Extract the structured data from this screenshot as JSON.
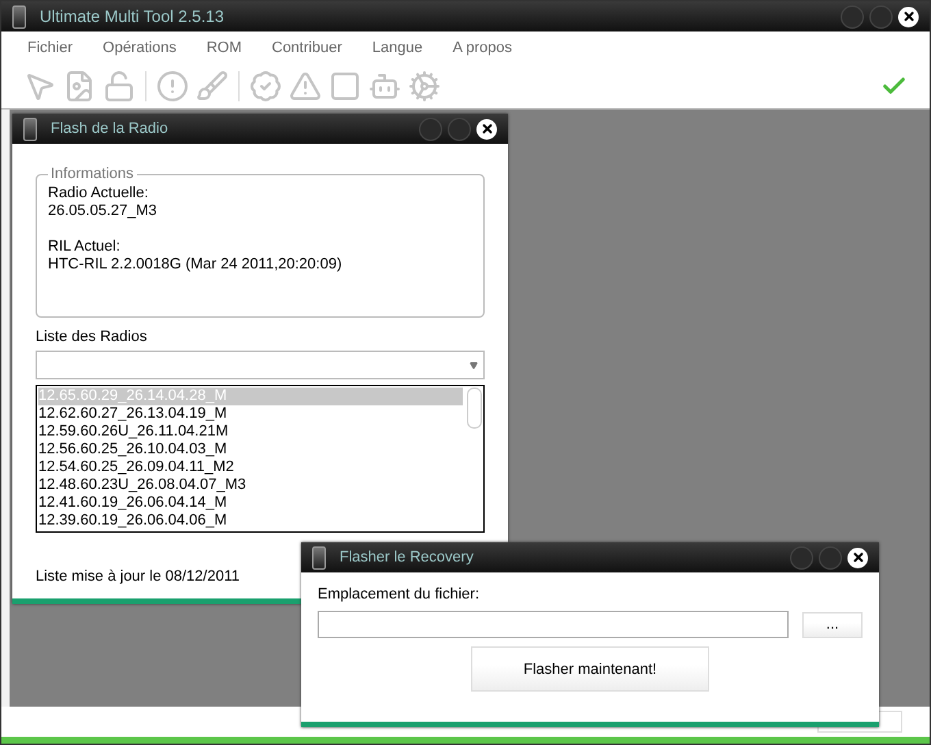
{
  "window": {
    "title": "Ultimate Multi Tool 2.5.13"
  },
  "menu": [
    "Fichier",
    "Opérations",
    "ROM",
    "Contribuer",
    "Langue",
    "A propos"
  ],
  "radio_window": {
    "title": "Flash de la Radio",
    "info_label": "Informations",
    "info_blocks": [
      [
        "Radio Actuelle:",
        "26.05.05.27_M3"
      ],
      [
        "RIL Actuel:",
        "HTC-RIL 2.2.0018G (Mar 24 2011,20:20:09)"
      ]
    ],
    "list_label": "Liste des Radios",
    "radios": [
      {
        "label": "12.65.60.29_26.14.04.28_M",
        "selected": true
      },
      {
        "label": "12.62.60.27_26.13.04.19_M",
        "selected": false
      },
      {
        "label": "12.59.60.26U_26.11.04.21M",
        "selected": false
      },
      {
        "label": "12.56.60.25_26.10.04.03_M",
        "selected": false
      },
      {
        "label": "12.54.60.25_26.09.04.11_M2",
        "selected": false
      },
      {
        "label": "12.48.60.23U_26.08.04.07_M3",
        "selected": false
      },
      {
        "label": "12.41.60.19_26.06.04.14_M",
        "selected": false
      },
      {
        "label": "12.39.60.19_26.06.04.06_M",
        "selected": false
      }
    ],
    "footer": "Liste mise à jour le 08/12/2011"
  },
  "recovery_window": {
    "title": "Flasher le Recovery",
    "field_label": "Emplacement du fichier:",
    "browse_button": "...",
    "flash_button": "Flasher maintenant!"
  }
}
